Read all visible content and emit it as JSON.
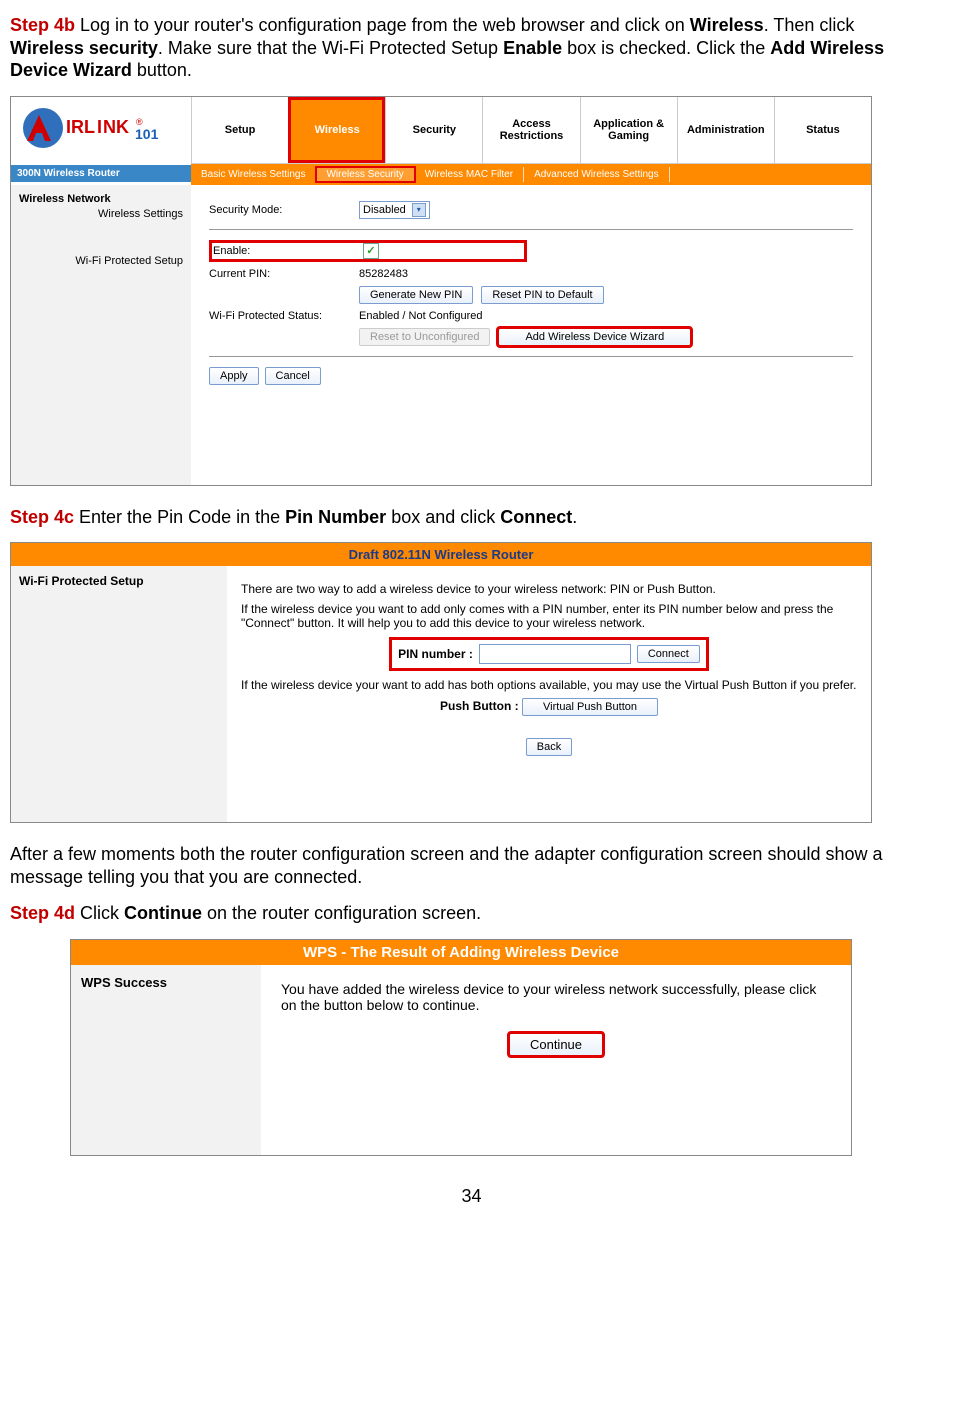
{
  "page_number": "34",
  "step4b": {
    "label": "Step 4b",
    "text_parts": {
      "t1": " Log in to your router's configuration page from the web browser and click on ",
      "b1": "Wireless",
      "t2": ".  Then click ",
      "b2": "Wireless security",
      "t3": ".  Make sure that the Wi-Fi Protected Setup ",
      "b3": "Enable",
      "t4": " box is checked.  Click the ",
      "b4": "Add Wireless Device Wizard",
      "t5": " button."
    }
  },
  "shot1": {
    "logo_text": "AirLink101",
    "model": "300N Wireless Router",
    "tabs": [
      "Setup",
      "Wireless",
      "Security",
      "Access Restrictions",
      "Application & Gaming",
      "Administration",
      "Status"
    ],
    "subtabs": [
      "Basic Wireless Settings",
      "Wireless Security",
      "Wireless MAC Filter",
      "Advanced Wireless Settings"
    ],
    "side": {
      "h1": "Wireless Network",
      "i1": "Wireless Settings",
      "i2": "Wi-Fi Protected Setup"
    },
    "security_mode_label": "Security Mode:",
    "security_mode_value": "Disabled",
    "enable_label": "Enable:",
    "current_pin_label": "Current PIN:",
    "current_pin_value": "85282483",
    "gen_pin_btn": "Generate New PIN",
    "reset_pin_btn": "Reset PIN to Default",
    "wps_status_label": "Wi-Fi Protected Status:",
    "wps_status_value": "Enabled / Not Configured",
    "reset_unconf_btn": "Reset to Unconfigured",
    "add_wizard_btn": "Add Wireless Device Wizard",
    "apply_btn": "Apply",
    "cancel_btn": "Cancel"
  },
  "step4c": {
    "label": "Step 4c",
    "text_parts": {
      "t1": " Enter the Pin Code in the ",
      "b1": "Pin Number",
      "t2": " box and click ",
      "b2": "Connect",
      "t3": "."
    }
  },
  "shot2": {
    "header": "Draft 802.11N Wireless Router",
    "left": "Wi-Fi Protected Setup",
    "p1": "There are two way to add a wireless device to your wireless network: PIN or Push Button.",
    "p2": "If the wireless device you want to add only comes with a PIN number, enter its PIN number below and press the \"Connect\" button. It will help you to add this device to your wireless network.",
    "pin_label": "PIN number :",
    "connect_btn": "Connect",
    "p3": "If the wireless device your want to add has both options available, you may use the Virtual Push Button if you prefer.",
    "push_label": "Push Button :",
    "push_btn": "Virtual Push Button",
    "back_btn": "Back"
  },
  "after_text": "After a few moments both the router configuration screen and the adapter configuration screen should show a message telling you that you are connected.",
  "step4d": {
    "label": "Step 4d",
    "text_parts": {
      "t1": " Click ",
      "b1": "Continue",
      "t2": " on the router configuration screen."
    }
  },
  "shot3": {
    "header": "WPS - The Result of Adding Wireless Device",
    "left": "WPS Success",
    "p1": "You have added the wireless device to your wireless network successfully, please click on the button below to continue.",
    "continue_btn": "Continue"
  }
}
